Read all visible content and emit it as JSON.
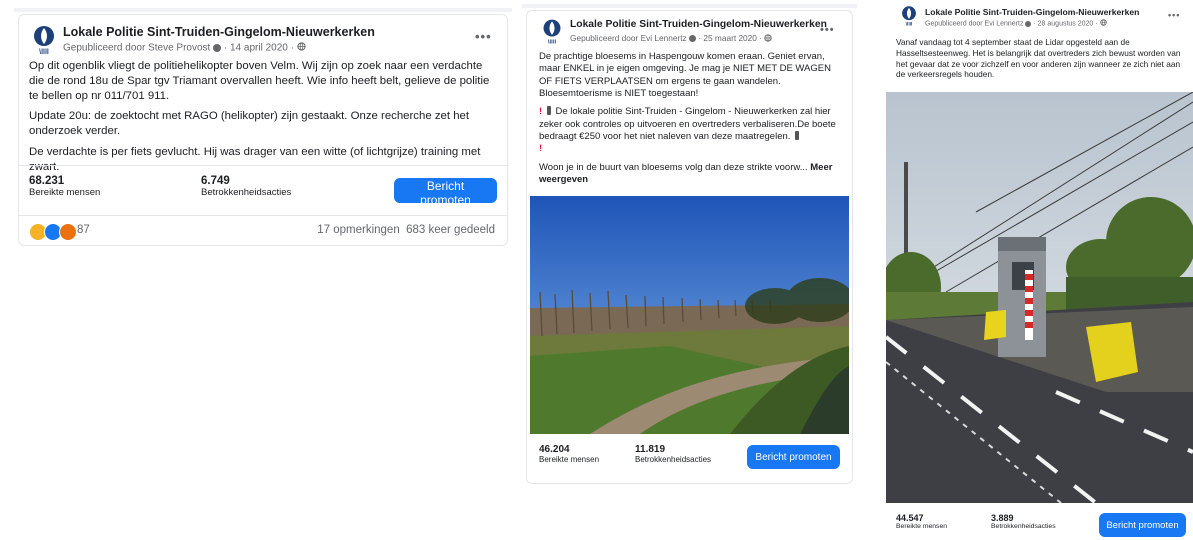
{
  "posts": [
    {
      "page_name": "Lokale Politie Sint-Truiden-Gingelom-Nieuwerkerken",
      "published_by": "Gepubliceerd door Steve Provost",
      "date": "14 april 2020",
      "paragraphs": [
        "Op dit ogenblik vliegt de politiehelikopter boven Velm. Wij zijn op zoek naar een verdachte die de rond 18u de Spar tgv Triamant overvallen heeft. Wie info heeft belt, gelieve de politie te bellen op nr 011/701 911.",
        "Update 20u: de zoektocht met RAGO (helikopter) zijn gestaakt. Onze recherche zet het onderzoek verder.",
        "De verdachte is per fiets gevlucht. Hij was drager van een witte (of lichtgrijze) training met zwart."
      ],
      "reach_value": "68.231",
      "reach_label": "Bereikte mensen",
      "engagement_value": "6.749",
      "engagement_label": "Betrokkenheidsacties",
      "promote_label": "Bericht promoten",
      "reactions_count": "87",
      "comments_shares": "17 opmerkingen  683 keer gedeeld"
    },
    {
      "page_name": "Lokale Politie Sint-Truiden-Gingelom-Nieuwerkerken",
      "published_by": "Gepubliceerd door Evi Lennertz",
      "date": "25 maart 2020",
      "para1": "De prachtige bloesems in Haspengouw komen eraan. Geniet ervan, maar ENKEL in je eigen omgeving. Je mag je NIET MET DE WAGEN OF FIETS VERPLAATSEN om ergens te gaan wandelen. Bloesemtoerisme is NIET toegestaan!",
      "para2": "De lokale politie Sint-Truiden - Gingelom - Nieuwerkerken zal hier zeker ook controles op uitvoeren en overtreders verbaliseren.De boete bedraagt €250 voor het niet naleven van deze maatregelen.",
      "para3": "Woon je in de buurt van bloesems volg dan deze strikte voorw...",
      "more_label": "Meer weergeven",
      "reach_value": "46.204",
      "reach_label": "Bereikte mensen",
      "engagement_value": "11.819",
      "engagement_label": "Betrokkenheidsacties",
      "promote_label": "Bericht promoten"
    },
    {
      "page_name": "Lokale Politie Sint-Truiden-Gingelom-Nieuwerkerken",
      "published_by": "Gepubliceerd door Evi Lennertz",
      "date": "28 augustus 2020",
      "paragraph": "Vanaf vandaag tot 4 september staat de Lidar opgesteld aan de Hasseltsesteenweg. Het is belangrijk dat overtreders zich bewust worden van het gevaar dat ze voor zichzelf en voor anderen zijn wanneer ze zich niet aan de verkeersregels houden.",
      "reach_value": "44.547",
      "reach_label": "Bereikte mensen",
      "engagement_value": "3.889",
      "engagement_label": "Betrokkenheidsacties",
      "promote_label": "Bericht promoten"
    }
  ],
  "colors": {
    "accent": "#1877f2",
    "secondary_text": "#65676b",
    "alert_red": "#e41e3f",
    "logo_blue": "#1d3f7a"
  },
  "icons": [
    "police-logo-icon",
    "globe-icon",
    "more-options-icon",
    "info-icon",
    "exclamation-icon",
    "traffic-light-icon",
    "wow-reaction-icon",
    "like-reaction-icon",
    "angry-reaction-icon"
  ]
}
